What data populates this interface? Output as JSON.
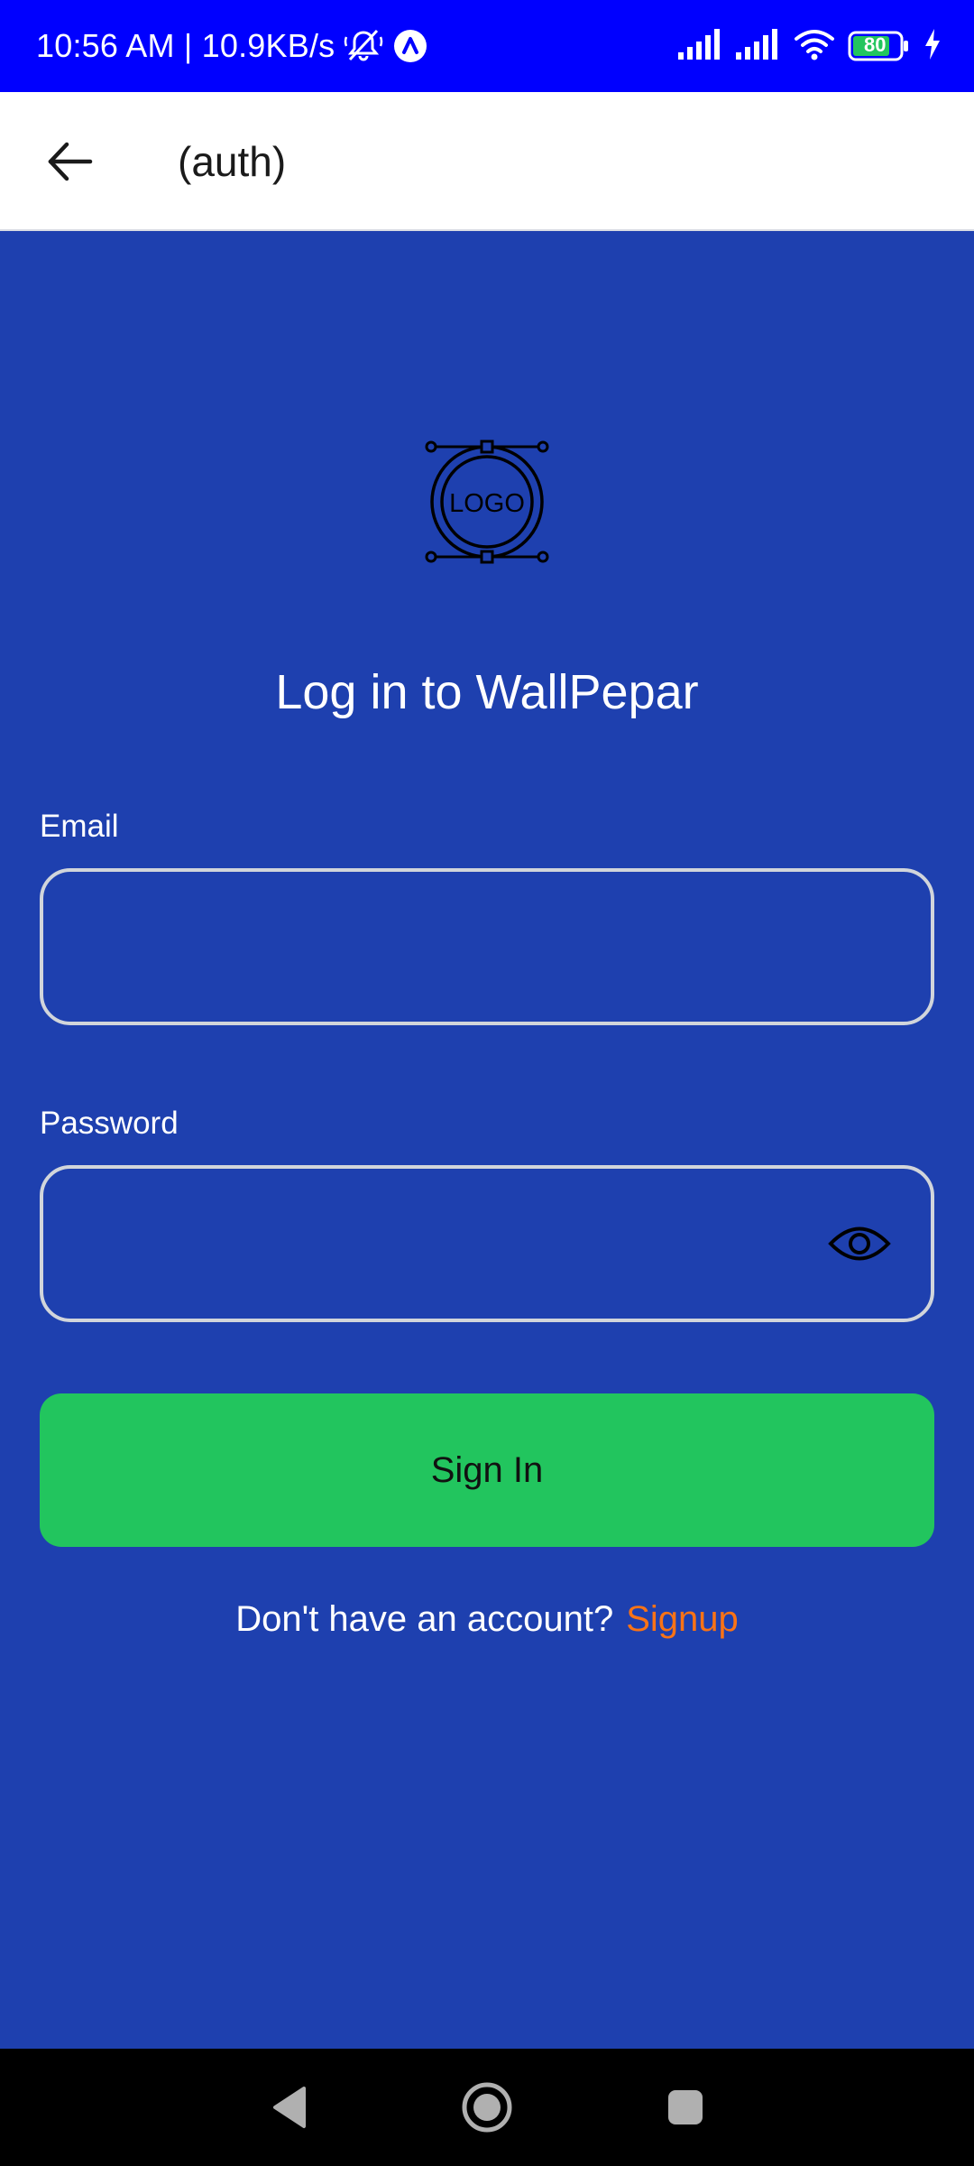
{
  "status_bar": {
    "time": "10:56 AM | 10.9KB/s",
    "battery_level": "80",
    "icons": [
      "mute-bell-icon",
      "app-notification-icon",
      "signal-icon",
      "signal-icon",
      "wifi-icon",
      "battery-icon",
      "charging-icon"
    ]
  },
  "app_bar": {
    "title": "(auth)",
    "back_icon": "arrow-left-icon"
  },
  "logo": {
    "text": "LOGO"
  },
  "login": {
    "title": "Log in to WallPepar",
    "email_label": "Email",
    "email_value": "",
    "password_label": "Password",
    "password_value": "",
    "password_toggle_icon": "eye-icon",
    "signin_label": "Sign In",
    "no_account_text": "Don't have an account?",
    "signup_link": "Signup"
  },
  "nav_bar": {
    "icons": [
      "nav-back-icon",
      "nav-home-icon",
      "nav-recents-icon"
    ]
  },
  "colors": {
    "status_bar": "#0000ff",
    "background": "#1e40af",
    "button": "#22c55e",
    "link": "#f97316",
    "field_border": "#d1d5db"
  }
}
